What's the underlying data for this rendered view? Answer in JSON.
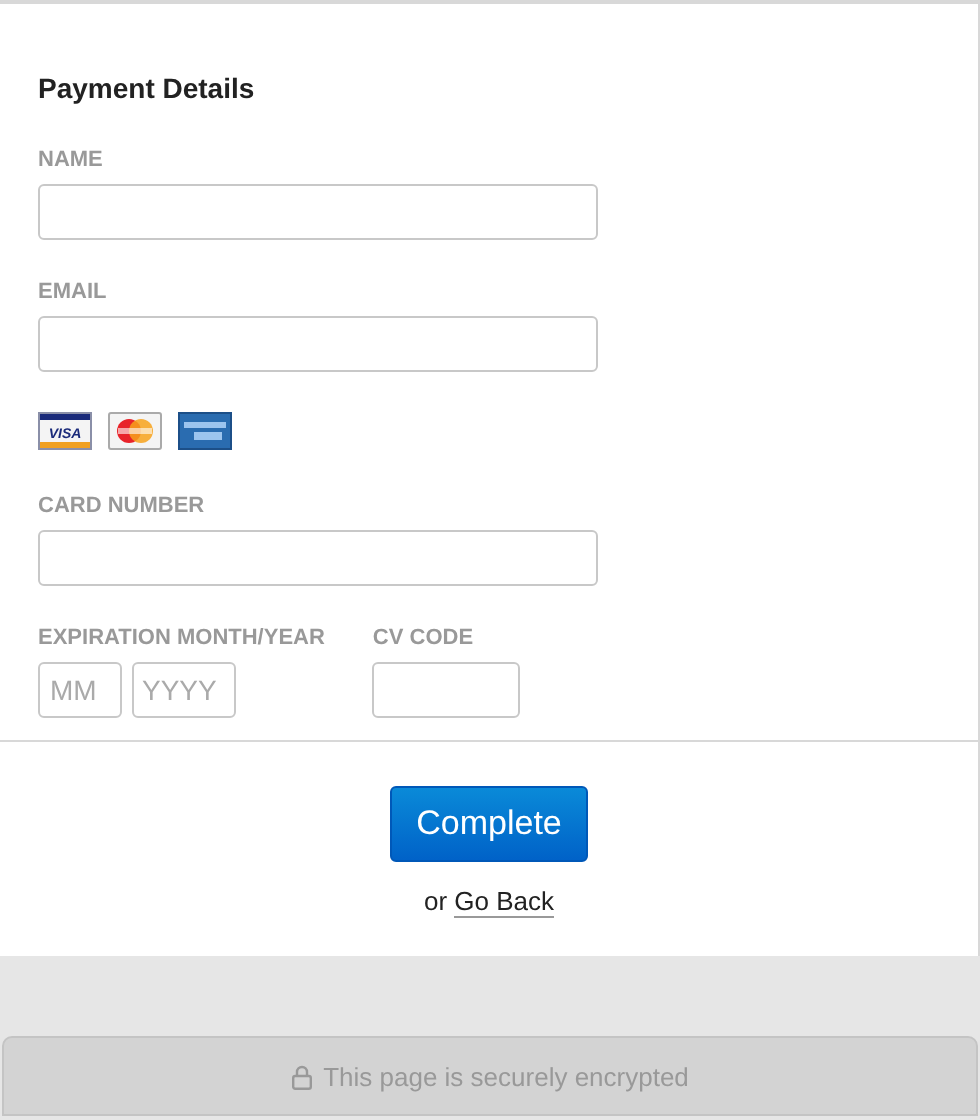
{
  "title": "Payment Details",
  "fields": [
    {
      "label": "NAME"
    },
    {
      "label": "EMAIL"
    }
  ],
  "cards": [
    {
      "kind": "visa",
      "label": "VISA"
    },
    {
      "kind": "mastercard"
    },
    {
      "kind": "amex"
    }
  ],
  "card_number": {
    "label": "CARD NUMBER"
  },
  "expiration": {
    "label": "EXPIRATION MONTH/YEAR",
    "month_placeholder": "MM",
    "year_placeholder": "YYYY"
  },
  "cv_code": {
    "label": "CV CODE"
  },
  "submit": "Complete",
  "back": {
    "prefix": "or",
    "link": "Go Back"
  },
  "security_note": "This page is securely encrypted"
}
